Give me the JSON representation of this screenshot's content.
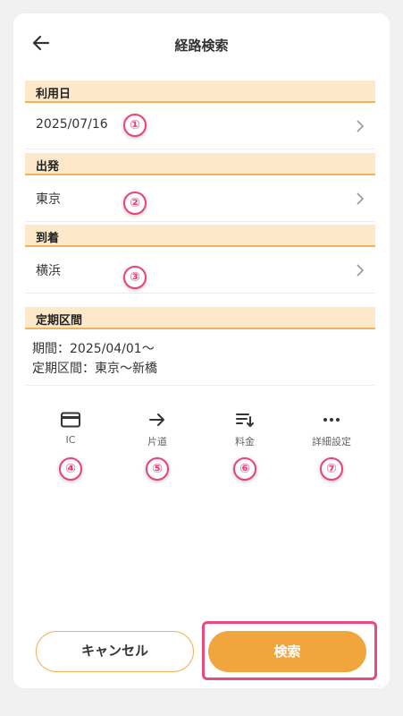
{
  "header": {
    "title": "経路検索",
    "back_icon": "arrow-left-icon"
  },
  "sections": {
    "date": {
      "label": "利用日",
      "value": "2025/07/16"
    },
    "departure": {
      "label": "出発",
      "value": "東京"
    },
    "arrival": {
      "label": "到着",
      "value": "横浜"
    },
    "commute": {
      "label": "定期区間",
      "period": "期間：2025/04/01〜",
      "route": "定期区間：東京〜新橋"
    }
  },
  "options": [
    {
      "label": "IC",
      "icon": "card-icon"
    },
    {
      "label": "片道",
      "icon": "arrow-right-icon"
    },
    {
      "label": "料金",
      "icon": "sort-icon"
    },
    {
      "label": "詳細設定",
      "icon": "more-icon"
    }
  ],
  "markers": [
    "①",
    "②",
    "③",
    "④",
    "⑤",
    "⑥",
    "⑦"
  ],
  "buttons": {
    "cancel": "キャンセル",
    "search": "検索"
  },
  "colors": {
    "accent": "#f0a63c",
    "section_bg": "#fde9c9",
    "highlight": "#e84a7b"
  }
}
